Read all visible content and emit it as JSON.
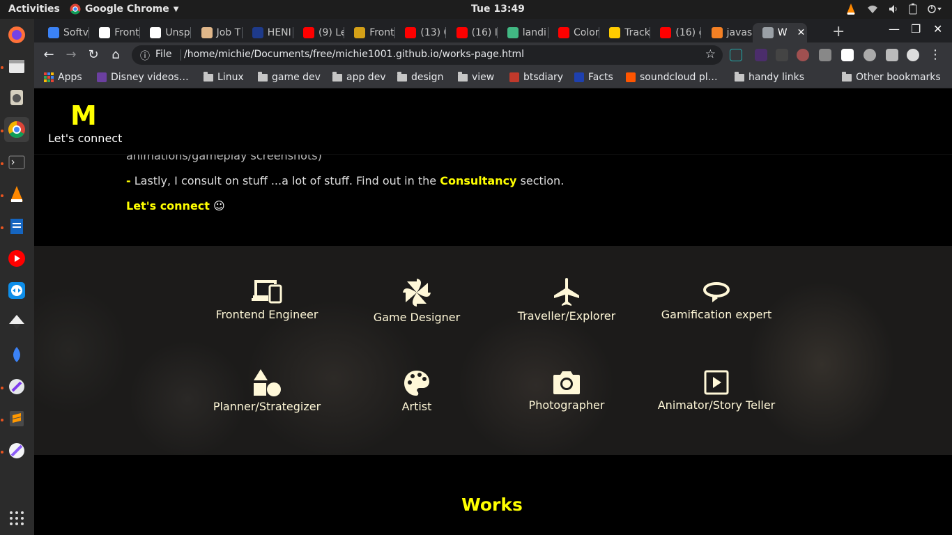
{
  "system": {
    "activities": "Activities",
    "app_name": "Google Chrome",
    "clock": "Tue 13:49"
  },
  "browser": {
    "tabs": [
      {
        "title": "Softv",
        "color": "#3b82f6"
      },
      {
        "title": "Front",
        "color": "#ffffff"
      },
      {
        "title": "Unsp",
        "color": "#ffffff"
      },
      {
        "title": "Job T",
        "color": "#e0b78a"
      },
      {
        "title": "HENI",
        "color": "#1e3a8a"
      },
      {
        "title": "(9) Le",
        "color": "#ff0000"
      },
      {
        "title": "Front",
        "color": "#d4a017"
      },
      {
        "title": "(13) C",
        "color": "#ff0000"
      },
      {
        "title": "(16) I",
        "color": "#ff0000"
      },
      {
        "title": "landi",
        "color": "#41b883"
      },
      {
        "title": "Color",
        "color": "#ff0000"
      },
      {
        "title": "Track",
        "color": "#ffcc00"
      },
      {
        "title": "(16) c",
        "color": "#ff0000"
      },
      {
        "title": "javas",
        "color": "#f48024"
      },
      {
        "title": "W",
        "color": "#9aa0a6"
      }
    ],
    "address": {
      "scheme": "File",
      "url": "/home/michie/Documents/free/michie1001.github.io/works-page.html"
    },
    "bookmarks": [
      {
        "label": "Apps",
        "type": "apps"
      },
      {
        "label": "Disney videos…",
        "type": "site",
        "color": "#6b3fa0"
      },
      {
        "label": "Linux",
        "type": "folder"
      },
      {
        "label": "game dev",
        "type": "folder"
      },
      {
        "label": "app dev",
        "type": "folder"
      },
      {
        "label": "design",
        "type": "folder"
      },
      {
        "label": "view",
        "type": "folder"
      },
      {
        "label": "btsdiary",
        "type": "site",
        "color": "#c0392b"
      },
      {
        "label": "Facts",
        "type": "site",
        "color": "#1e40af"
      },
      {
        "label": "soundcloud pl…",
        "type": "site",
        "color": "#ff5500"
      },
      {
        "label": "handy links",
        "type": "folder"
      }
    ],
    "other_bookmarks": "Other bookmarks"
  },
  "site": {
    "logo": "M",
    "logo_sub": "Let's connect",
    "intro": {
      "line_faded": "animations/gameplay screenshots)",
      "lastly_dash": "-",
      "lastly_text_a": " Lastly, I consult on stuff ...a lot of stuff. Find out in the ",
      "lastly_link": "Consultancy",
      "lastly_text_b": " section.",
      "connect_link": "Let's connect",
      "connect_emoji": "☺"
    },
    "skills": [
      {
        "label": "Frontend Engineer",
        "icon": "devices-icon"
      },
      {
        "label": "Game Designer",
        "icon": "pinwheel-icon"
      },
      {
        "label": "Traveller/Explorer",
        "icon": "airplane-icon"
      },
      {
        "label": "Gamification expert",
        "icon": "loop-arrow-icon"
      },
      {
        "label": "Planner/Strategizer",
        "icon": "shapes-icon"
      },
      {
        "label": "Artist",
        "icon": "palette-icon"
      },
      {
        "label": "Photographer",
        "icon": "camera-icon"
      },
      {
        "label": "Animator/Story Teller",
        "icon": "play-box-icon"
      }
    ],
    "works_heading": "Works",
    "accent": "#ffff00"
  }
}
